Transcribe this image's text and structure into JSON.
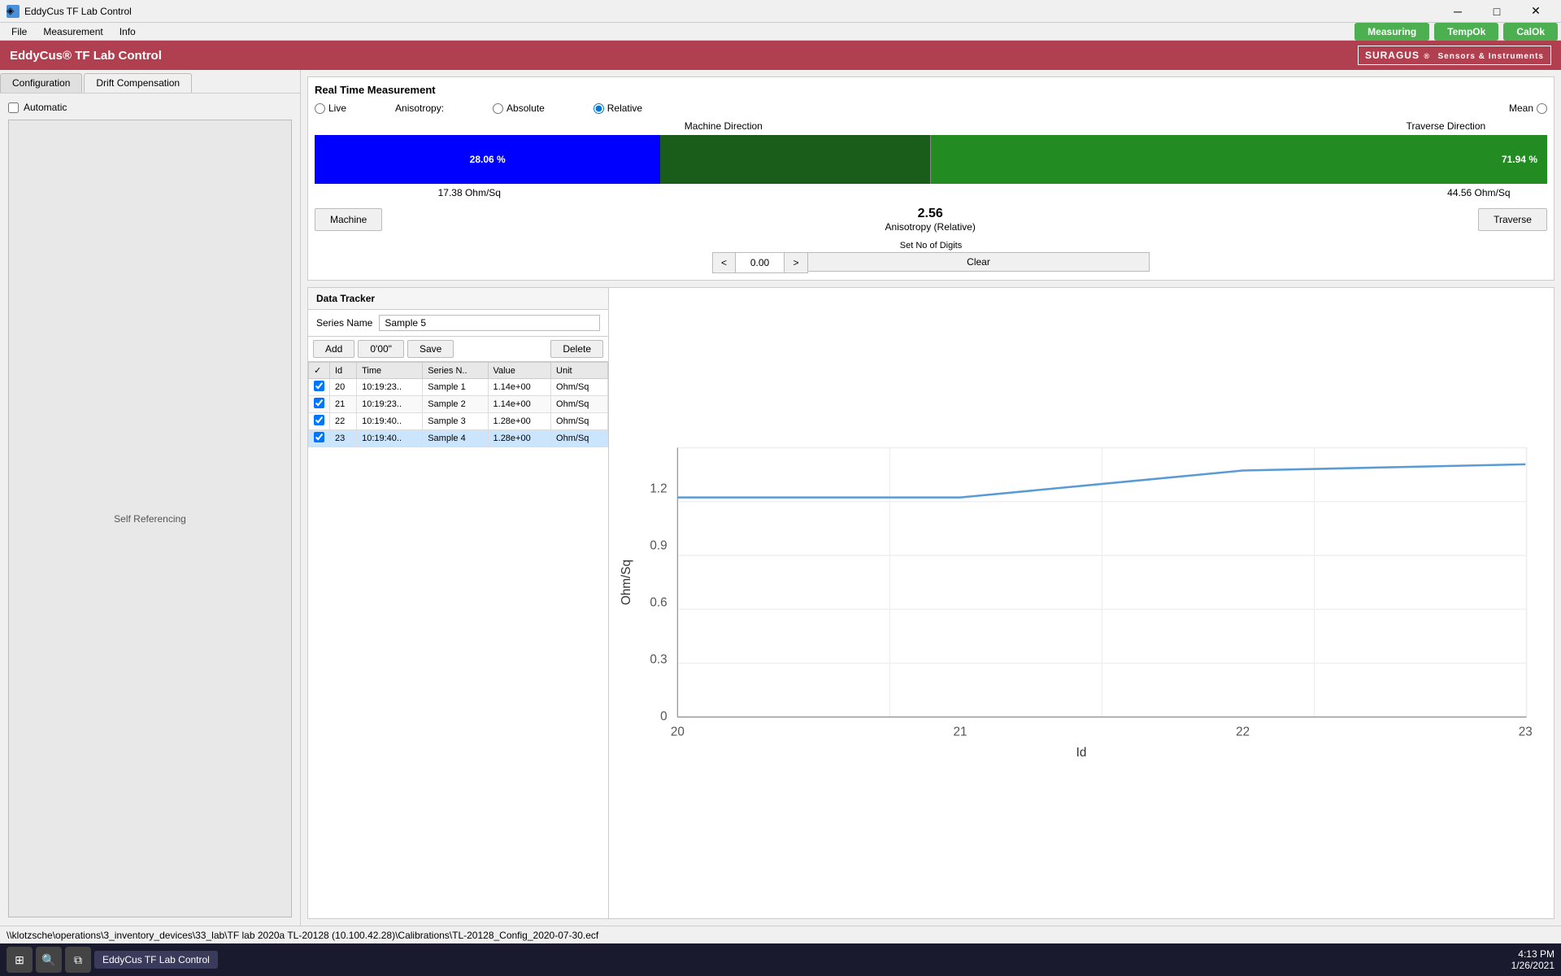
{
  "titlebar": {
    "title": "EddyCus TF Lab Control",
    "icon": "◈",
    "min_btn": "─",
    "max_btn": "□",
    "close_btn": "✕"
  },
  "menubar": {
    "items": [
      "File",
      "Measurement",
      "Info"
    ]
  },
  "statusbar_top": {
    "app_title": "EddyCus® TF Lab Control",
    "buttons": {
      "measuring": "Measuring",
      "tempok": "TempOk",
      "calok": "CalOk"
    },
    "logo": "SURAGUS"
  },
  "tabs_left": {
    "tab1": "Configuration",
    "tab2": "Drift Compensation"
  },
  "left_panel": {
    "automatic_label": "Automatic",
    "self_ref_label": "Self Referencing"
  },
  "rtm": {
    "title": "Real Time Measurement",
    "live_label": "Live",
    "anisotropy_label": "Anisotropy:",
    "absolute_label": "Absolute",
    "relative_label": "Relative",
    "mean_label": "Mean",
    "machine_direction": "Machine Direction",
    "traverse_direction": "Traverse Direction",
    "bar_blue_pct": "28.06 %",
    "bar_green_pct": "71.94 %",
    "machine_value": "17.38 Ohm/Sq",
    "traverse_value": "44.56 Ohm/Sq",
    "anisotropy_value": "2.56",
    "anisotropy_sub": "Anisotropy (Relative)",
    "machine_btn": "Machine",
    "traverse_btn": "Traverse",
    "digits_label": "Set No of Digits",
    "digits_dec_btn": "<",
    "digits_val": "0.00",
    "digits_inc_btn": ">",
    "clear_btn": "Clear",
    "blue_pct": 28.06,
    "green_pct": 71.94
  },
  "data_tracker": {
    "title": "Data Tracker",
    "series_label": "Series Name",
    "series_value": "Sample 5",
    "add_btn": "Add",
    "time_btn": "0'00\"",
    "save_btn": "Save",
    "delete_btn": "Delete",
    "table_headers": [
      "",
      "Id",
      "Time",
      "Series N..",
      "Value",
      "Unit"
    ],
    "rows": [
      {
        "id": 20,
        "time": "10:19:23..",
        "series": "Sample 1",
        "value": "1.14e+00",
        "unit": "Ohm/Sq",
        "checked": true,
        "selected": false
      },
      {
        "id": 21,
        "time": "10:19:23..",
        "series": "Sample 2",
        "value": "1.14e+00",
        "unit": "Ohm/Sq",
        "checked": true,
        "selected": false
      },
      {
        "id": 22,
        "time": "10:19:40..",
        "series": "Sample 3",
        "value": "1.28e+00",
        "unit": "Ohm/Sq",
        "checked": true,
        "selected": false
      },
      {
        "id": 23,
        "time": "10:19:40..",
        "series": "Sample 4",
        "value": "1.28e+00",
        "unit": "Ohm/Sq",
        "checked": true,
        "selected": true
      }
    ]
  },
  "chart": {
    "y_label": "Ohm/Sq",
    "x_label": "Id",
    "y_ticks": [
      "0",
      "0.3",
      "0.6",
      "0.9",
      "1.2"
    ],
    "x_ticks": [
      "20",
      "21",
      "22",
      "23"
    ],
    "data_points": [
      {
        "x": 20,
        "y": 1.14
      },
      {
        "x": 21,
        "y": 1.14
      },
      {
        "x": 22,
        "y": 1.28
      },
      {
        "x": 23,
        "y": 1.3
      }
    ]
  },
  "statusbar_bottom": {
    "path": "\\\\klotzsche\\operations\\3_inventory_devices\\33_lab\\TF lab 2020a TL-20128 (10.100.42.28)\\Calibrations\\TL-20128_Config_2020-07-30.ecf"
  },
  "taskbar": {
    "time": "4:13 PM",
    "date": "1/26/2021",
    "app_label": "EddyCus TF Lab Control"
  }
}
